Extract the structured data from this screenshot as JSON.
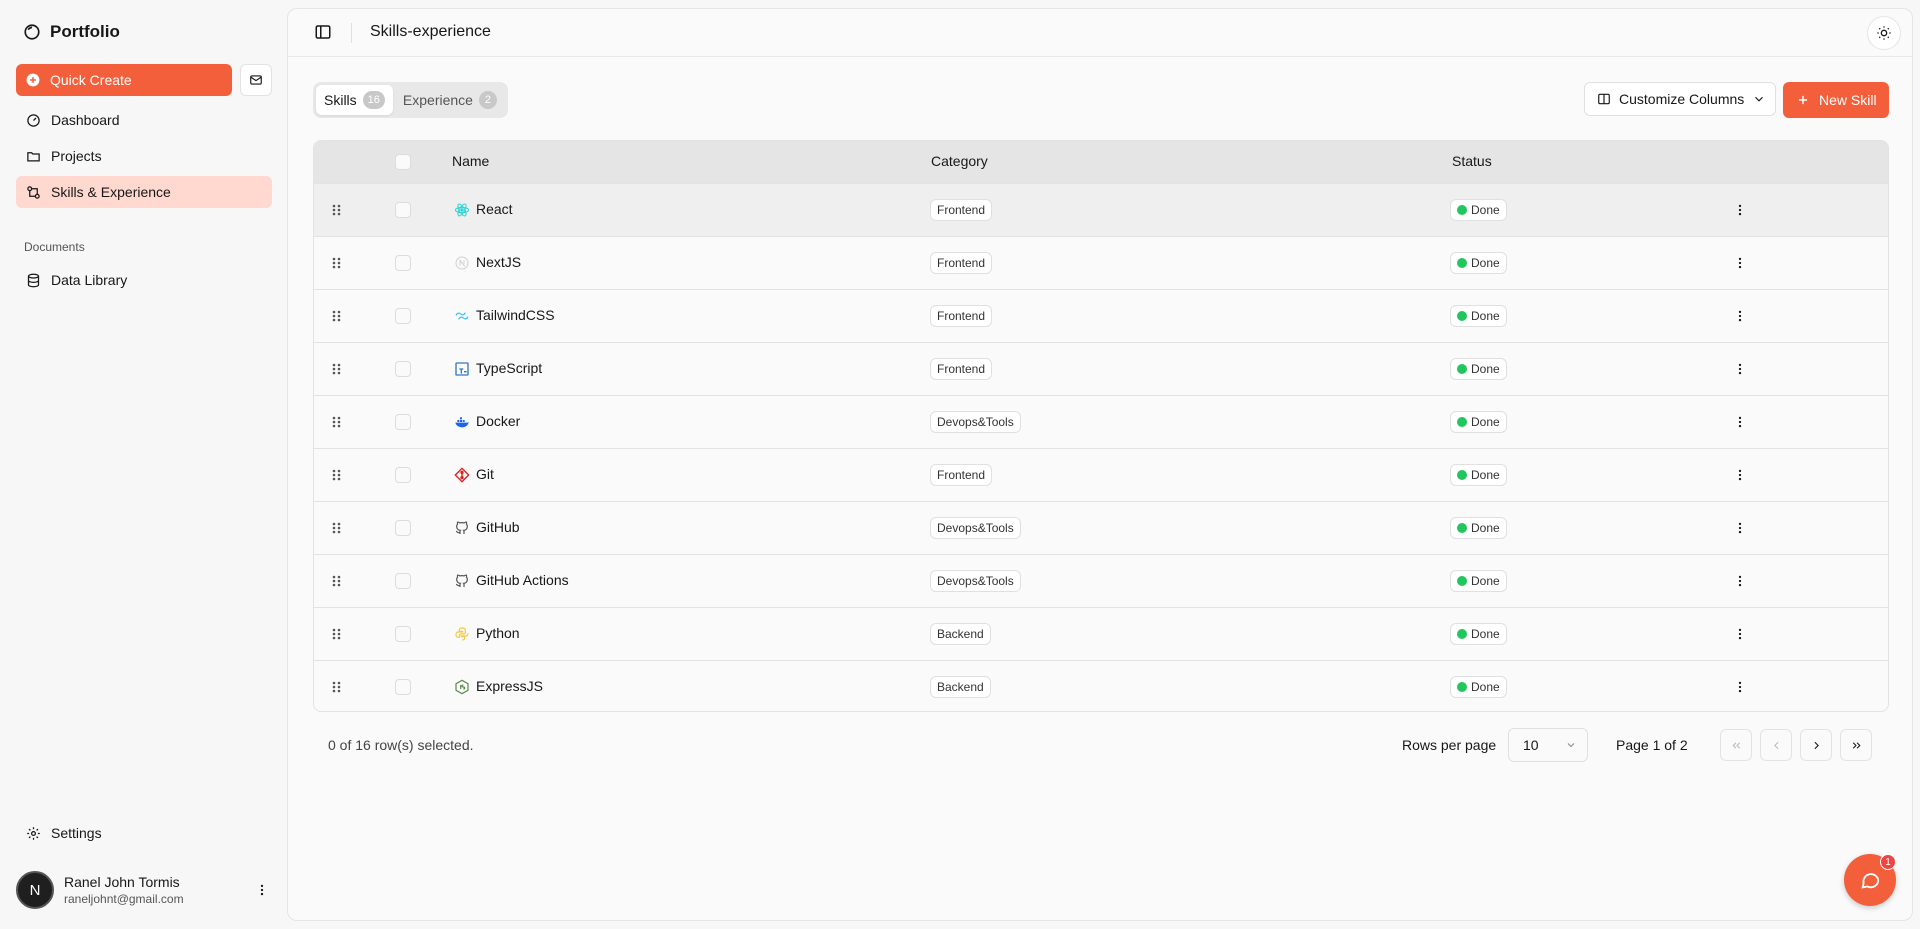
{
  "brand": {
    "title": "Portfolio"
  },
  "sidebar": {
    "quick_create": "Quick Create",
    "items": [
      {
        "label": "Dashboard",
        "icon": "gauge-icon"
      },
      {
        "label": "Projects",
        "icon": "folder-icon"
      },
      {
        "label": "Skills & Experience",
        "icon": "git-compare-icon",
        "active": true
      }
    ],
    "section_label": "Documents",
    "documents": [
      {
        "label": "Data Library",
        "icon": "database-icon"
      }
    ],
    "settings_label": "Settings",
    "user": {
      "initial": "N",
      "name": "Ranel John Tormis",
      "email": "raneljohnt@gmail.com"
    }
  },
  "header": {
    "title": "Skills-experience"
  },
  "tabs": [
    {
      "label": "Skills",
      "count": "16",
      "active": true
    },
    {
      "label": "Experience",
      "count": "2",
      "active": false
    }
  ],
  "toolbar": {
    "customize_label": "Customize Columns",
    "new_label": "New Skill"
  },
  "table": {
    "columns": {
      "name": "Name",
      "category": "Category",
      "status": "Status"
    },
    "rows": [
      {
        "name": "React",
        "category": "Frontend",
        "status": "Done",
        "icon": "react-icon"
      },
      {
        "name": "NextJS",
        "category": "Frontend",
        "status": "Done",
        "icon": "nextjs-icon"
      },
      {
        "name": "TailwindCSS",
        "category": "Frontend",
        "status": "Done",
        "icon": "tailwind-icon"
      },
      {
        "name": "TypeScript",
        "category": "Frontend",
        "status": "Done",
        "icon": "typescript-icon"
      },
      {
        "name": "Docker",
        "category": "Devops&Tools",
        "status": "Done",
        "icon": "docker-icon"
      },
      {
        "name": "Git",
        "category": "Frontend",
        "status": "Done",
        "icon": "git-icon"
      },
      {
        "name": "GitHub",
        "category": "Devops&Tools",
        "status": "Done",
        "icon": "github-icon"
      },
      {
        "name": "GitHub Actions",
        "category": "Devops&Tools",
        "status": "Done",
        "icon": "github-icon"
      },
      {
        "name": "Python",
        "category": "Backend",
        "status": "Done",
        "icon": "python-icon"
      },
      {
        "name": "ExpressJS",
        "category": "Backend",
        "status": "Done",
        "icon": "nodejs-icon"
      }
    ]
  },
  "footer": {
    "selected": "0 of 16 row(s) selected.",
    "rows_per_page_label": "Rows per page",
    "rows_per_page_value": "10",
    "page_label": "Page 1 of 2"
  },
  "chat": {
    "badge": "1"
  },
  "colors": {
    "accent": "#f25f3a",
    "active_nav": "#ffd9cf",
    "status_green": "#22c55e"
  }
}
